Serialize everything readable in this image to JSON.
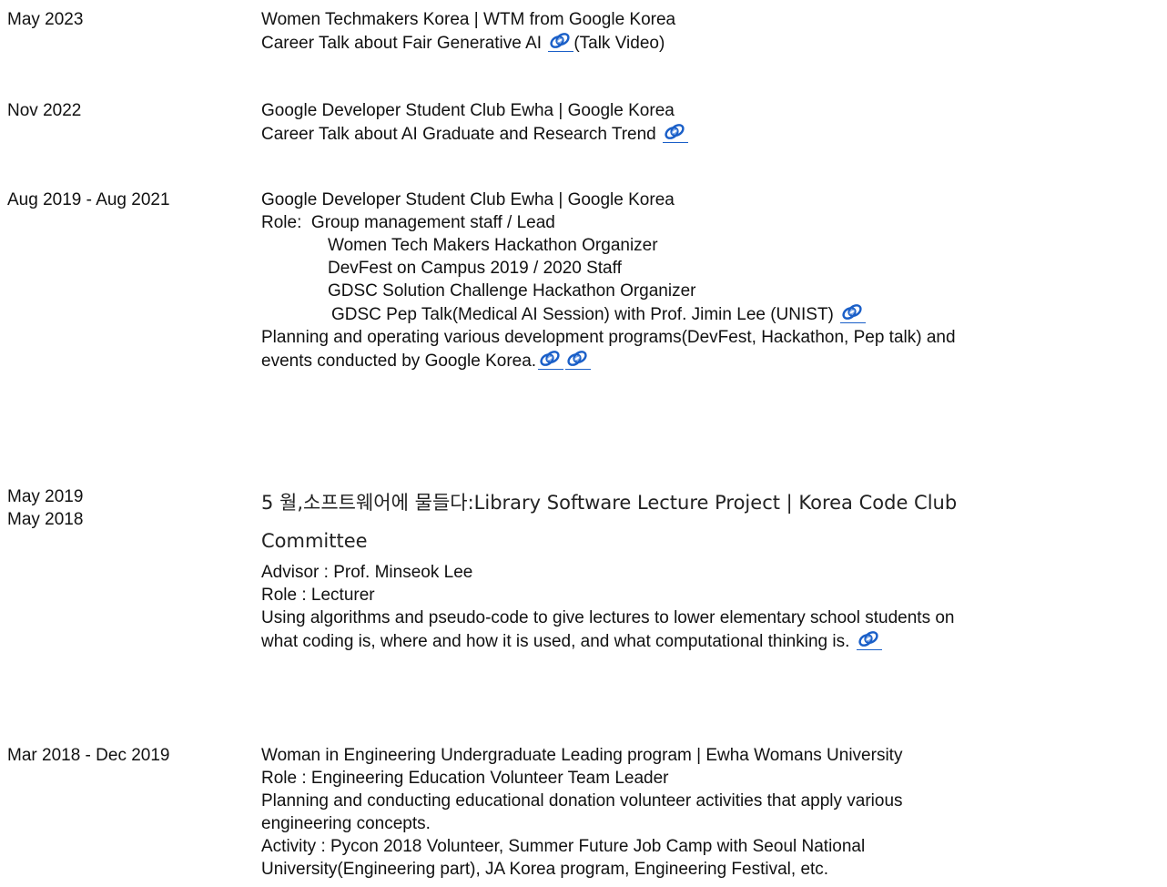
{
  "entries": [
    {
      "date": "May 2023",
      "title": "Women Techmakers Korea | WTM from Google Korea",
      "line2_text": "Career Talk about Fair Generative AI",
      "line2_link": "(Talk Video)"
    },
    {
      "date": "Nov 2022",
      "title": "Google Developer Student Club Ewha | Google Korea",
      "line2_text": "Career Talk about AI Graduate and Research Trend"
    },
    {
      "date": "Aug 2019 - Aug 2021",
      "title": "Google Developer Student Club Ewha | Google Korea",
      "role_label": "Role:",
      "role_first": "Group management staff / Lead",
      "roles": [
        "Women Tech Makers Hackathon Organizer",
        "DevFest on Campus 2019 / 2020 Staff",
        "GDSC Solution Challenge Hackathon Organizer",
        "GDSC Pep Talk(Medical AI Session) with Prof. Jimin Lee (UNIST)"
      ],
      "description_1": "Planning and operating various development programs(DevFest, Hackathon, Pep talk) and",
      "description_2": "events conducted by Google Korea."
    },
    {
      "date_1": "May 2019",
      "date_2": "May 2018",
      "title_line_1": "5 월,소프트웨어에 물들다:Library Software Lecture Project | Korea Code Club",
      "title_line_2": "Committee",
      "advisor": "Advisor : Prof. Minseok Lee",
      "role": "Role : Lecturer",
      "description_1": "Using algorithms and pseudo-code to give lectures to lower elementary school students on",
      "description_2": "what coding is, where and how it is used, and what computational thinking is."
    },
    {
      "date": "Mar 2018 - Dec 2019",
      "title": "Woman in Engineering Undergraduate Leading program | Ewha Womans University",
      "role": "Role : Engineering Education Volunteer Team Leader",
      "description_1": "Planning and conducting educational donation volunteer activities that apply various",
      "description_2": "engineering concepts.",
      "activity_1": "Activity : Pycon 2018 Volunteer, Summer Future Job Camp with Seoul National",
      "activity_2": "University(Engineering part), JA Korea program, Engineering Festival, etc."
    }
  ],
  "icon": {
    "name": "link-icon",
    "color": "#1a5fc8"
  }
}
